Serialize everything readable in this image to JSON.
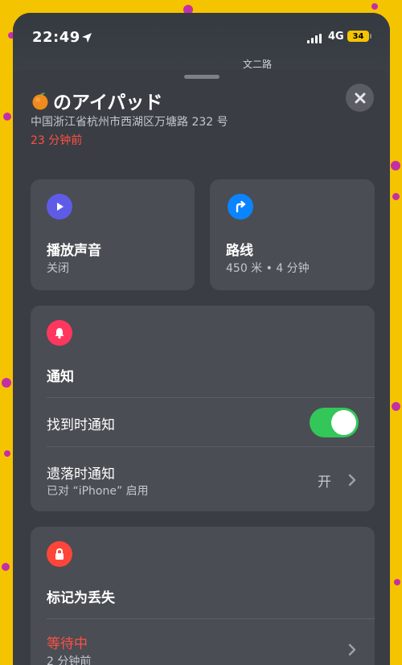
{
  "status_bar": {
    "time": "22:49",
    "network": "4G",
    "battery": "34"
  },
  "map": {
    "road_label": "文二路"
  },
  "device": {
    "name": "のアイパッド",
    "emoji": "orange",
    "address": "中国浙江省杭州市西湖区万塘路 232 号",
    "last_seen": "23 分钟前"
  },
  "actions": {
    "play_sound": {
      "title": "播放声音",
      "subtitle": "关闭",
      "icon": "play-icon",
      "color": "#5e5ce6"
    },
    "directions": {
      "title": "路线",
      "subtitle": "450 米 • 4 分钟",
      "icon": "turn-right-arrow-icon",
      "color": "#0a84ff"
    }
  },
  "notifications": {
    "title": "通知",
    "icon": "bell-icon",
    "color": "#ff375f",
    "notify_when_found": {
      "label": "找到时通知",
      "enabled": true
    },
    "notify_when_left_behind": {
      "label": "遗落时通知",
      "sublabel": "已对 “iPhone” 启用",
      "value": "开"
    }
  },
  "mark_as_lost": {
    "title": "标记为丢失",
    "icon": "lock-icon",
    "color": "#ff453a",
    "status": {
      "label": "等待中",
      "sublabel": "2 分钟前"
    }
  },
  "colors": {
    "background": "#f5c400",
    "sheet": "#3a3d43",
    "card": "#4a4d53",
    "warning_red": "#ff5045",
    "toggle_on": "#33c659"
  }
}
